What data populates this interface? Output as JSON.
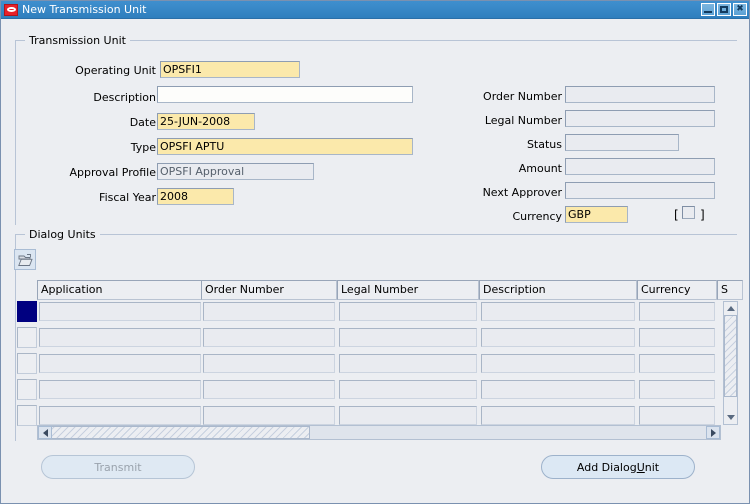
{
  "window": {
    "title": "New Transmission Unit",
    "icon": "oracle-logo-icon",
    "controls": {
      "minimize": "minimize-icon",
      "maximize": "maximize-icon",
      "close": "close-icon",
      "close_glyph": "✖"
    }
  },
  "transmission_unit": {
    "group_title": "Transmission Unit",
    "fields": [
      {
        "label": "Operating Unit",
        "value": "OPSFI1",
        "state": "required"
      },
      {
        "label": "Description",
        "value": "",
        "state": "white"
      },
      {
        "label": "Date",
        "value": "25-JUN-2008",
        "state": "required"
      },
      {
        "label": "Type",
        "value": "OPSFI APTU",
        "state": "required"
      },
      {
        "label": "Approval Profile",
        "value": "OPSFI Approval",
        "state": "disabled"
      },
      {
        "label": "Fiscal Year",
        "value": "2008",
        "state": "required"
      }
    ],
    "right_fields": [
      {
        "label": "Order Number",
        "value": "",
        "state": "disabled"
      },
      {
        "label": "Legal Number",
        "value": "",
        "state": "disabled"
      },
      {
        "label": "Status",
        "value": "",
        "state": "disabled"
      },
      {
        "label": "Amount",
        "value": "",
        "state": "disabled"
      },
      {
        "label": "Next Approver",
        "value": "",
        "state": "disabled"
      },
      {
        "label": "Currency",
        "value": "GBP",
        "state": "required"
      }
    ],
    "currency_flag": {
      "bracket_open": "[",
      "bracket_close": "]",
      "checked": false
    }
  },
  "dialog_units": {
    "group_title": "Dialog Units",
    "toolbar": {
      "open_label": "folder-open-icon"
    },
    "columns": [
      "Application",
      "Order Number",
      "Legal Number",
      "Description",
      "Currency",
      "S"
    ],
    "rows": [
      {
        "selected": true,
        "cells": [
          "",
          "",
          "",
          "",
          "",
          ""
        ]
      },
      {
        "selected": false,
        "cells": [
          "",
          "",
          "",
          "",
          "",
          ""
        ]
      },
      {
        "selected": false,
        "cells": [
          "",
          "",
          "",
          "",
          "",
          ""
        ]
      },
      {
        "selected": false,
        "cells": [
          "",
          "",
          "",
          "",
          "",
          ""
        ]
      },
      {
        "selected": false,
        "cells": [
          "",
          "",
          "",
          "",
          "",
          ""
        ]
      }
    ]
  },
  "actions": {
    "transmit": {
      "label": "Transmit",
      "enabled": false
    },
    "add_dialog_unit": {
      "label_before": "Add Dialog ",
      "mnemonic": "U",
      "label_after": "nit"
    }
  },
  "colors": {
    "title_bar": "#2f7fbe",
    "required_field": "#fbe9ab",
    "disabled_field": "#e9ebf0",
    "selected_row": "#000080",
    "window_bg": "#eceef2"
  }
}
